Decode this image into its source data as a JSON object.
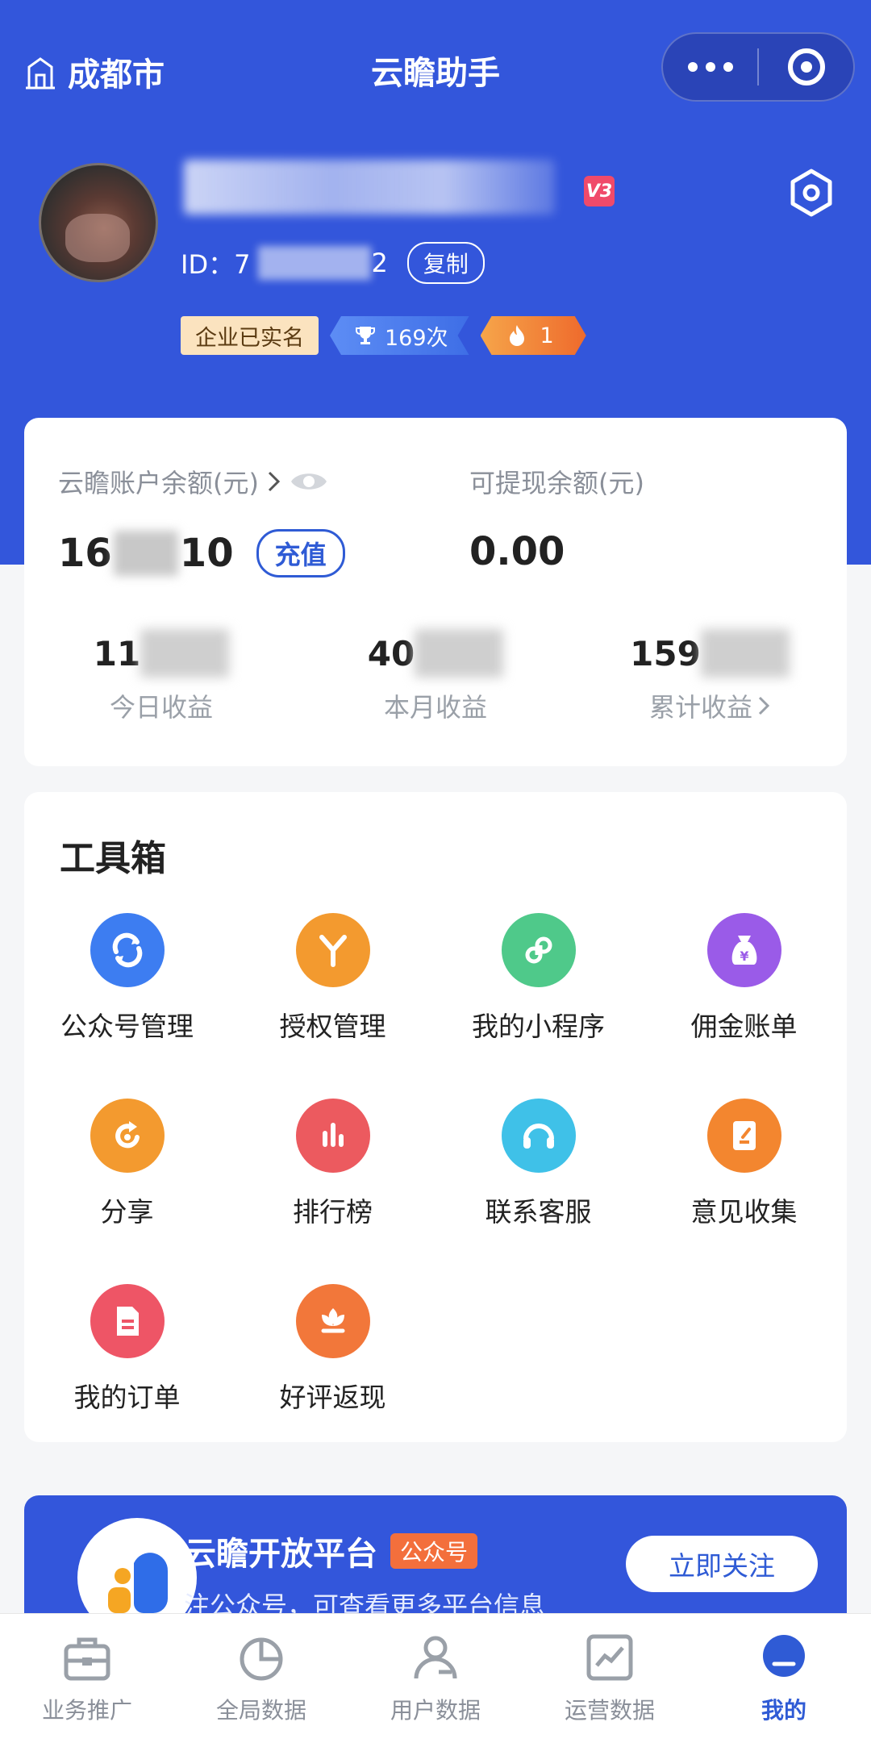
{
  "topbar": {
    "city": "成都市",
    "title": "云瞻助手"
  },
  "profile": {
    "id_label": "ID：7",
    "id_suffix": "2",
    "copy_label": "复制",
    "vip_badge": "V3",
    "tags": {
      "verified": "企业已实名",
      "trophy_count": "169次",
      "fire_count": "1"
    }
  },
  "balance": {
    "account_label": "云瞻账户余额(元)",
    "account_prefix": "16",
    "account_suffix": "10",
    "recharge_label": "充值",
    "withdraw_label": "可提现余额(元)",
    "withdraw_value": "0.00",
    "stats": [
      {
        "prefix": "11",
        "label": "今日收益"
      },
      {
        "prefix": "40",
        "label": "本月收益"
      },
      {
        "prefix": "159",
        "label": "累计收益"
      }
    ]
  },
  "toolbox": {
    "title": "工具箱",
    "items": [
      {
        "label": "公众号管理",
        "icon": "wechat-account-icon",
        "color": "#3d7df1"
      },
      {
        "label": "授权管理",
        "icon": "authorize-icon",
        "color": "#f39a2f"
      },
      {
        "label": "我的小程序",
        "icon": "mini-program-icon",
        "color": "#4fc98a"
      },
      {
        "label": "佣金账单",
        "icon": "money-bag-icon",
        "color": "#9a5be8"
      },
      {
        "label": "分享",
        "icon": "share-icon",
        "color": "#f39a2f"
      },
      {
        "label": "排行榜",
        "icon": "ranking-icon",
        "color": "#ec5a5f"
      },
      {
        "label": "联系客服",
        "icon": "headset-icon",
        "color": "#3fc1e8"
      },
      {
        "label": "意见收集",
        "icon": "feedback-icon",
        "color": "#f3862f"
      },
      {
        "label": "我的订单",
        "icon": "order-icon",
        "color": "#ee5566"
      },
      {
        "label": "好评返现",
        "icon": "flower-icon",
        "color": "#f2773a"
      }
    ]
  },
  "promo": {
    "title": "云瞻开放平台",
    "tag": "公众号",
    "subtitle": "注公众号，可查看更多平台信息",
    "button": "立即关注"
  },
  "tabbar": {
    "items": [
      {
        "label": "业务推广",
        "icon": "briefcase-icon"
      },
      {
        "label": "全局数据",
        "icon": "pie-chart-icon"
      },
      {
        "label": "用户数据",
        "icon": "user-icon"
      },
      {
        "label": "运营数据",
        "icon": "line-chart-icon"
      },
      {
        "label": "我的",
        "icon": "profile-icon"
      }
    ],
    "active": "我的"
  }
}
